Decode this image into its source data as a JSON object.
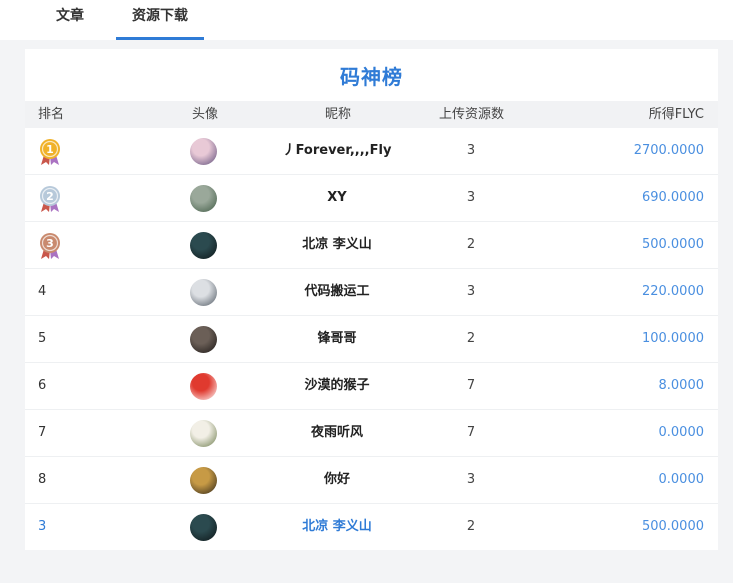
{
  "tabs": [
    {
      "label": "文章",
      "active": false
    },
    {
      "label": "资源下载",
      "active": true
    }
  ],
  "leaderboard": {
    "title": "码神榜",
    "columns": [
      "排名",
      "头像",
      "昵称",
      "上传资源数",
      "所得FLYC"
    ],
    "rows": [
      {
        "rank": "1",
        "medal": "gold",
        "name": "丿Forever,,,,Fly",
        "count": "3",
        "reward": "2700.0000",
        "avatar_colors": [
          "#e8c9d6",
          "#5b4a78"
        ]
      },
      {
        "rank": "2",
        "medal": "silver",
        "name": "XY",
        "count": "3",
        "reward": "690.0000",
        "avatar_colors": [
          "#9aa89a",
          "#3f5a44"
        ]
      },
      {
        "rank": "3",
        "medal": "bronze",
        "name": "北凉 李义山",
        "count": "2",
        "reward": "500.0000",
        "avatar_colors": [
          "#2b4a4f",
          "#0c1416"
        ]
      },
      {
        "rank": "4",
        "medal": "",
        "name": "代码搬运工",
        "count": "3",
        "reward": "220.0000",
        "avatar_colors": [
          "#dcdfe3",
          "#4d5660"
        ]
      },
      {
        "rank": "5",
        "medal": "",
        "name": "锋哥哥",
        "count": "2",
        "reward": "100.0000",
        "avatar_colors": [
          "#6b5f57",
          "#1a1614"
        ]
      },
      {
        "rank": "6",
        "medal": "",
        "name": "沙漠的猴子",
        "count": "7",
        "reward": "8.0000",
        "avatar_colors": [
          "#e03a2f",
          "#ffffff"
        ]
      },
      {
        "rank": "7",
        "medal": "",
        "name": "夜雨听风",
        "count": "7",
        "reward": "0.0000",
        "avatar_colors": [
          "#f2efe6",
          "#6a7a4a"
        ]
      },
      {
        "rank": "8",
        "medal": "",
        "name": "你好",
        "count": "3",
        "reward": "0.0000",
        "avatar_colors": [
          "#c79a45",
          "#2c2418"
        ]
      },
      {
        "rank": "3",
        "medal": "",
        "name": "北凉 李义山",
        "count": "2",
        "reward": "500.0000",
        "avatar_colors": [
          "#2b4a4f",
          "#0c1416"
        ],
        "current_user": true
      }
    ]
  },
  "colors": {
    "accent": "#2f7bd6",
    "reward": "#4a8fe0",
    "gold": "#f0b22a",
    "silver": "#b7c9da",
    "bronze": "#c98a6e"
  }
}
